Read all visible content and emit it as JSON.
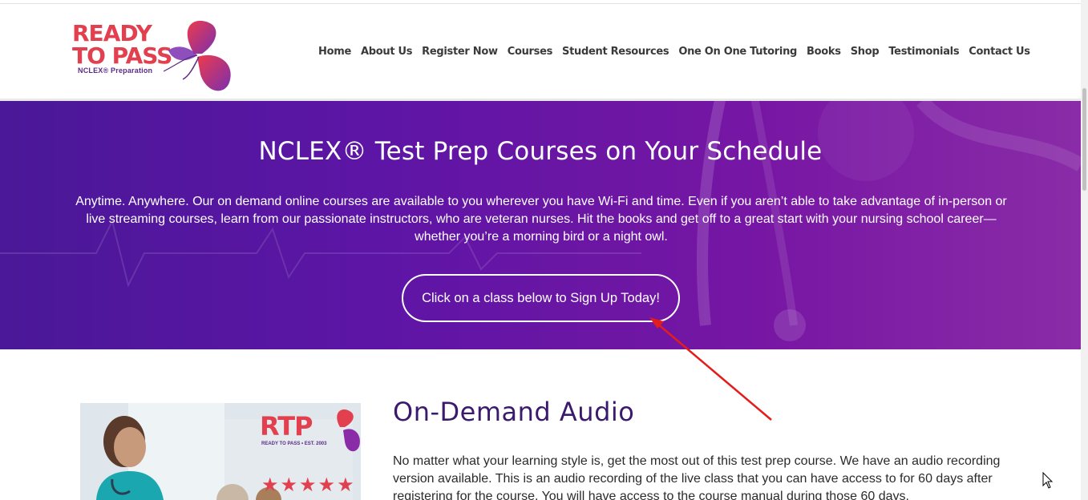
{
  "brand": {
    "logo_line1": "READY",
    "logo_line2": "TO PASS",
    "logo_tagline": "NCLEX® Preparation",
    "primary_color": "#e2404f",
    "accent_color": "#5b2a86"
  },
  "nav": {
    "items": [
      {
        "label": "Home"
      },
      {
        "label": "About Us"
      },
      {
        "label": "Register Now"
      },
      {
        "label": "Courses"
      },
      {
        "label": "Student Resources"
      },
      {
        "label": "One On One Tutoring"
      },
      {
        "label": "Books"
      },
      {
        "label": "Shop"
      },
      {
        "label": "Testimonials"
      },
      {
        "label": "Contact Us"
      }
    ]
  },
  "hero": {
    "title": "NCLEX® Test Prep Courses on Your Schedule",
    "body": "Anytime. Anywhere. Our on demand online courses are available to you wherever you have Wi-Fi and time. Even if you aren’t able to take advantage of in-person or live streaming courses, learn from our passionate instructors, who are veteran nurses. Hit the books and get off to a great start with your nursing school career—whether you’re a morning bird or a night owl.",
    "button_label": "Click on a class below to Sign Up Today!",
    "bg_color": "#5d15a5"
  },
  "section": {
    "title": "On-Demand Audio",
    "body": "No matter what your learning style is, get the most out of this test prep course. We have an audio recording version available. This is an audio recording of the live class that you can have access to for 60 days after registering for the course. You will have access to the course manual during those 60 days.",
    "thumb_logo": "RTP",
    "thumb_tagline": "READY TO PASS • EST. 2003",
    "title_color": "#3b1a6e"
  }
}
